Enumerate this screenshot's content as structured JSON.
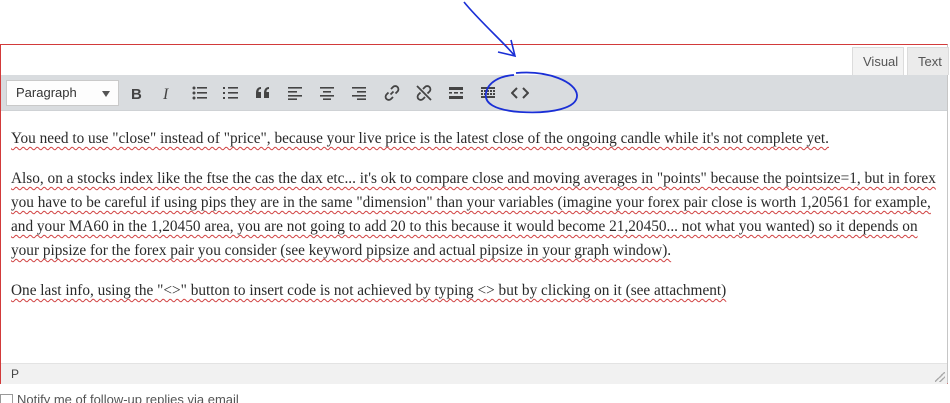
{
  "editor": {
    "tabs": {
      "visual": "Visual",
      "text": "Text"
    },
    "toolbar": {
      "format_value": "Paragraph",
      "buttons": [
        "bold-icon",
        "italic-icon",
        "bulleted-list-icon",
        "numbered-list-icon",
        "blockquote-icon",
        "align-left-icon",
        "align-center-icon",
        "align-right-icon",
        "link-icon",
        "unlink-icon",
        "read-more-icon",
        "toolbar-toggle-icon",
        "code-icon"
      ]
    },
    "content": {
      "p1": "You need to use \"close\" instead of \"price\", because your live price is the latest close of the ongoing candle while it's not complete yet.",
      "p2": "Also, on a stocks index like the ftse the cas the dax etc... it's ok to compare close and moving averages in \"points\" because the pointsize=1, but in forex you have to be careful if using pips they are in the same \"dimension\" than your variables (imagine your forex pair close is worth 1,20561 for example, and your MA60 in the 1,20450 area, you are not going to add 20 to this because it would become 21,20450... not what you wanted) so it depends on your pipsize for the forex pair you consider (see keyword pipsize and actual pipsize in your graph window).",
      "p3": "One last info, using the \"<>\" button to insert code is not achieved by typing <> but by clicking on it (see attachment)"
    },
    "status_path": "P"
  },
  "notify_label": "Notify me of follow-up replies via email",
  "colors": {
    "annotation": "#1a2fd6",
    "frame_border": "#d23a3a",
    "toolbar_bg": "#d9dcdf"
  }
}
